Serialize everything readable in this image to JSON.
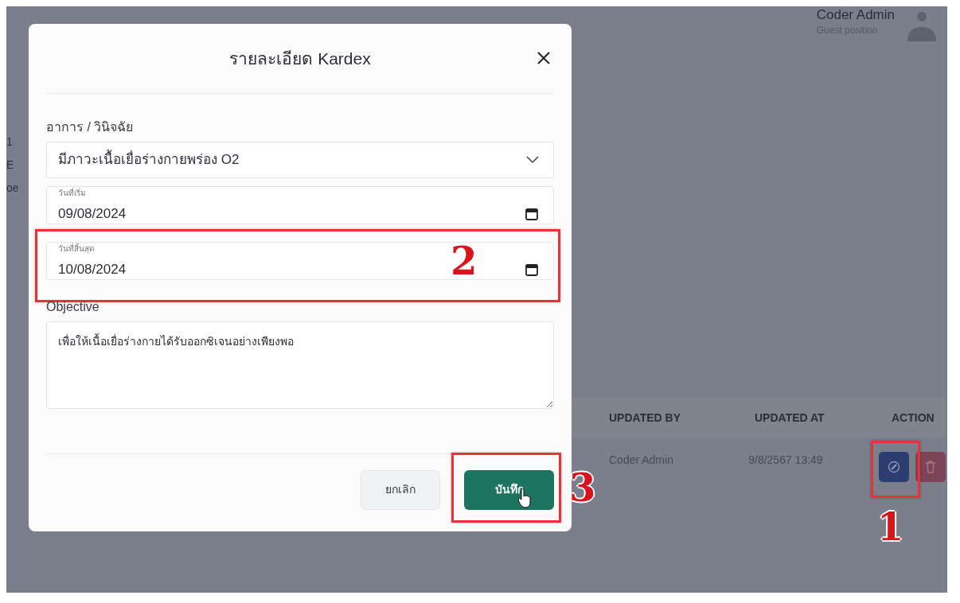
{
  "page": {
    "user": {
      "name": "Coder Admin",
      "position": "Guest position"
    },
    "edge_texts": [
      "1",
      "E",
      "oe"
    ],
    "table": {
      "columns": [
        "UPDATED BY",
        "UPDATED AT",
        "ACTION"
      ],
      "rows": [
        {
          "updated_by": "Coder Admin",
          "updated_at": "9/8/2567 13:49",
          "step": "1"
        }
      ]
    }
  },
  "modal": {
    "title": "รายละเอียด Kardex",
    "fields": [
      {
        "kind": "select",
        "label": "อาการ / วินิจฉัย",
        "value": "มีภาวะเนื้อเยื่อร่างกายพร่อง O2"
      },
      {
        "kind": "date",
        "label": "วันที่เริ่ม",
        "value": "09/08/2024"
      },
      {
        "kind": "date",
        "label": "วันที่สิ้นสุด",
        "value": "10/08/2024",
        "step": "2"
      },
      {
        "kind": "textarea",
        "label": "Objective",
        "value": "เพื่อให้เนื้อเยื่อร่างกายได้รับออกซิเจนอย่างเพียงพอ"
      }
    ],
    "buttons": [
      {
        "label": "ยกเลิก",
        "kind": "secondary"
      },
      {
        "label": "บันทึก",
        "kind": "primary",
        "step": "3"
      }
    ]
  }
}
